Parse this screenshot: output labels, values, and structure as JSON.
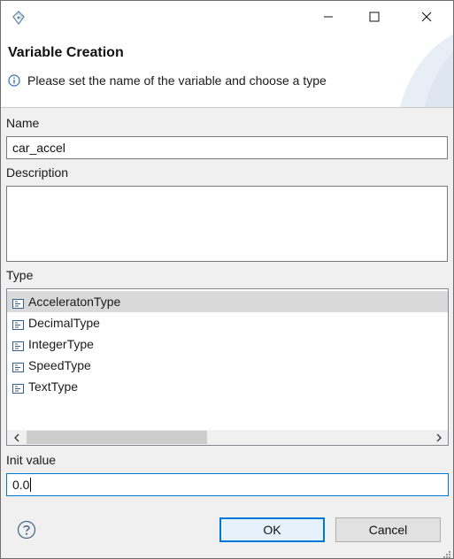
{
  "window": {
    "icons": {
      "app": "dialog-app-icon",
      "minimize": "minimize-icon",
      "maximize": "maximize-icon",
      "close": "close-icon"
    }
  },
  "banner": {
    "title": "Variable Creation",
    "message": "Please set the name of the variable and choose a type",
    "message_icon": "info-icon"
  },
  "form": {
    "name_label": "Name",
    "name_value": "car_accel",
    "description_label": "Description",
    "description_value": "",
    "type_label": "Type",
    "types": [
      {
        "label": "AcceleratonType",
        "selected": true
      },
      {
        "label": "DecimalType",
        "selected": false
      },
      {
        "label": "IntegerType",
        "selected": false
      },
      {
        "label": "SpeedType",
        "selected": false
      },
      {
        "label": "TextType",
        "selected": false
      }
    ],
    "init_value_label": "Init value",
    "init_value": "0.0"
  },
  "buttons": {
    "ok": "OK",
    "cancel": "Cancel",
    "help_icon": "help-icon"
  },
  "colors": {
    "accent": "#0078d7",
    "selection": "#d9d9d9"
  }
}
